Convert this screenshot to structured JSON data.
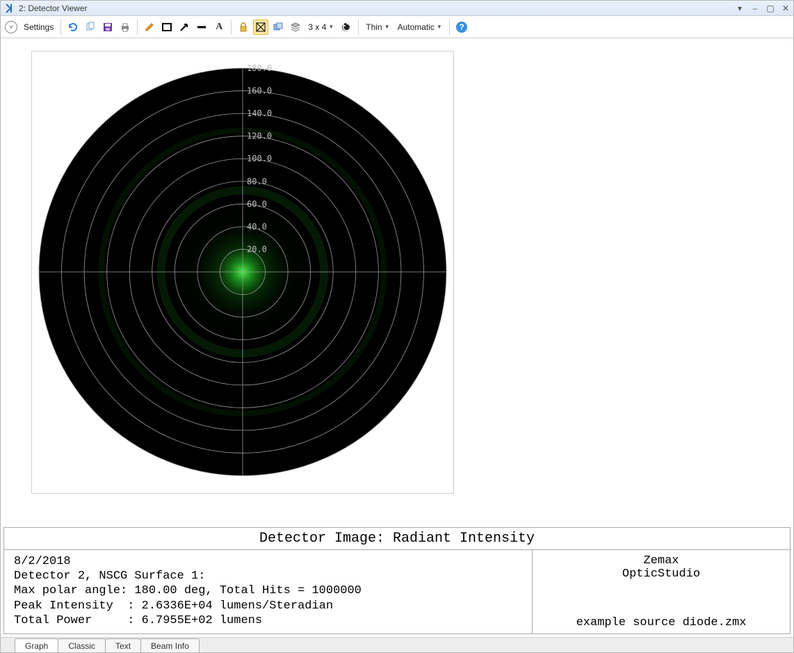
{
  "window": {
    "title": "2: Detector Viewer",
    "controls": {
      "dropdown": "▾",
      "minimize": "–",
      "maximize": "▢",
      "close": "✕"
    }
  },
  "toolbar": {
    "settings_label": "Settings",
    "grid_label": "3 x 4",
    "line_label": "Thin",
    "auto_label": "Automatic",
    "icons": {
      "refresh": "refresh",
      "copy": "copy",
      "save": "save",
      "print": "print",
      "pencil": "pencil",
      "rect": "rect",
      "arrow": "arrow",
      "line": "line",
      "text": "A",
      "lock": "lock",
      "zoom_window": "zoom-window",
      "windows": "windows",
      "stack": "stack",
      "reload": "reload",
      "help": "?"
    }
  },
  "chart_data": {
    "type": "polar-intensity",
    "rings": [
      20.0,
      40.0,
      60.0,
      80.0,
      100.0,
      120.0,
      140.0,
      160.0,
      180.0
    ],
    "ring_labels": [
      "20.0",
      "40.0",
      "60.0",
      "80.0",
      "100.0",
      "120.0",
      "140.0",
      "160.0",
      "180.0"
    ],
    "title": "Detector Image: Radiant Intensity",
    "xlabel": "",
    "ylabel": "",
    "max_polar_angle": 180.0,
    "units": "lumens/Steradian",
    "peak_intensity": 26336.0
  },
  "info": {
    "title": "Detector Image: Radiant Intensity",
    "date": "8/2/2018",
    "detector_line": "Detector 2, NSCG Surface 1:",
    "max_polar_line": "Max polar angle: 180.00 deg, Total Hits = 1000000",
    "peak_line": "Peak Intensity  : 2.6336E+04 lumens/Steradian",
    "power_line": "Total Power     : 6.7955E+02 lumens",
    "brand1": "Zemax",
    "brand2": "OpticStudio",
    "filename": "example source diode.zmx"
  },
  "tabs": {
    "items": [
      "Graph",
      "Classic",
      "Text",
      "Beam Info"
    ],
    "selected": 0
  }
}
